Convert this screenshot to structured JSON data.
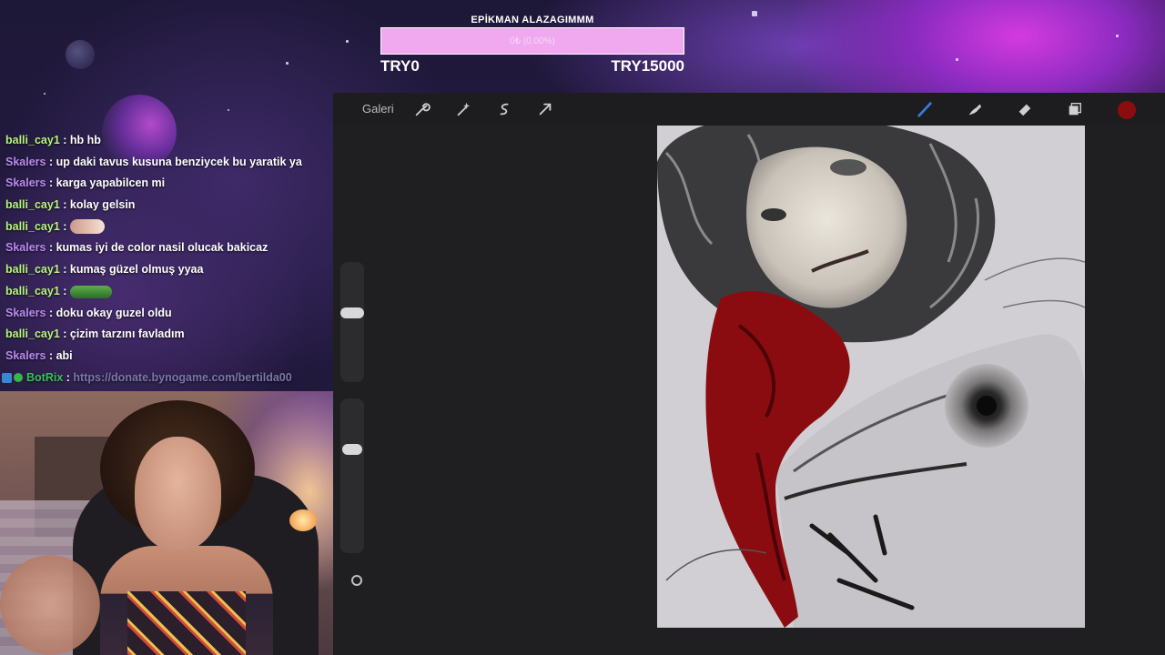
{
  "goal": {
    "title": "EPİKMAN ALAZAGIMMM",
    "progress_text": "0₺ (0.00%)",
    "progress_percent": 0,
    "min_label": "TRY0",
    "max_label": "TRY15000"
  },
  "chat": [
    {
      "user": "balli_cay1",
      "color": "green",
      "sep": " : ",
      "message": "hb hb"
    },
    {
      "user": "Skalers",
      "color": "purple",
      "sep": " : ",
      "message": "up daki tavus kusuna benziycek bu yaratik ya"
    },
    {
      "user": "Skalers",
      "color": "purple",
      "sep": " : ",
      "message": "karga yapabilcen mi"
    },
    {
      "user": "balli_cay1",
      "color": "green",
      "sep": " : ",
      "message": "kolay gelsin"
    },
    {
      "user": "balli_cay1",
      "color": "green",
      "sep": " : ",
      "emote": "hand-emote"
    },
    {
      "user": "Skalers",
      "color": "purple",
      "sep": " : ",
      "message": "kumas iyi de color nasil olucak bakicaz"
    },
    {
      "user": "balli_cay1",
      "color": "green",
      "sep": " : ",
      "message": "kumaş güzel olmuş yyaa"
    },
    {
      "user": "balli_cay1",
      "color": "green",
      "sep": " : ",
      "emote": "frog-emote"
    },
    {
      "user": "Skalers",
      "color": "purple",
      "sep": " : ",
      "message": "doku okay guzel oldu"
    },
    {
      "user": "balli_cay1",
      "color": "green",
      "sep": " : ",
      "message": "çizim tarzını favladım"
    },
    {
      "user": "Skalers",
      "color": "purple",
      "sep": " : ",
      "message": "abi"
    }
  ],
  "bot": {
    "user": "BotRix",
    "sep": " : ",
    "link": "https://donate.bynogame.com/bertilda00"
  },
  "app": {
    "gallery_label": "Galeri",
    "tools_left": [
      "wrench-icon",
      "magic-wand-icon",
      "selection-icon",
      "transform-arrow-icon"
    ],
    "tools_right": [
      "brush-icon",
      "smudge-icon",
      "eraser-icon",
      "layers-icon"
    ],
    "active_color": "#8b0d0d",
    "brush_size_percent": 35,
    "opacity_percent": 35
  },
  "colors": {
    "green_user": "#b6f57b",
    "purple_user": "#b98af0",
    "goal_bar": "#f0a8ef",
    "bot_name": "#39c05a",
    "link": "#7a78a8"
  }
}
